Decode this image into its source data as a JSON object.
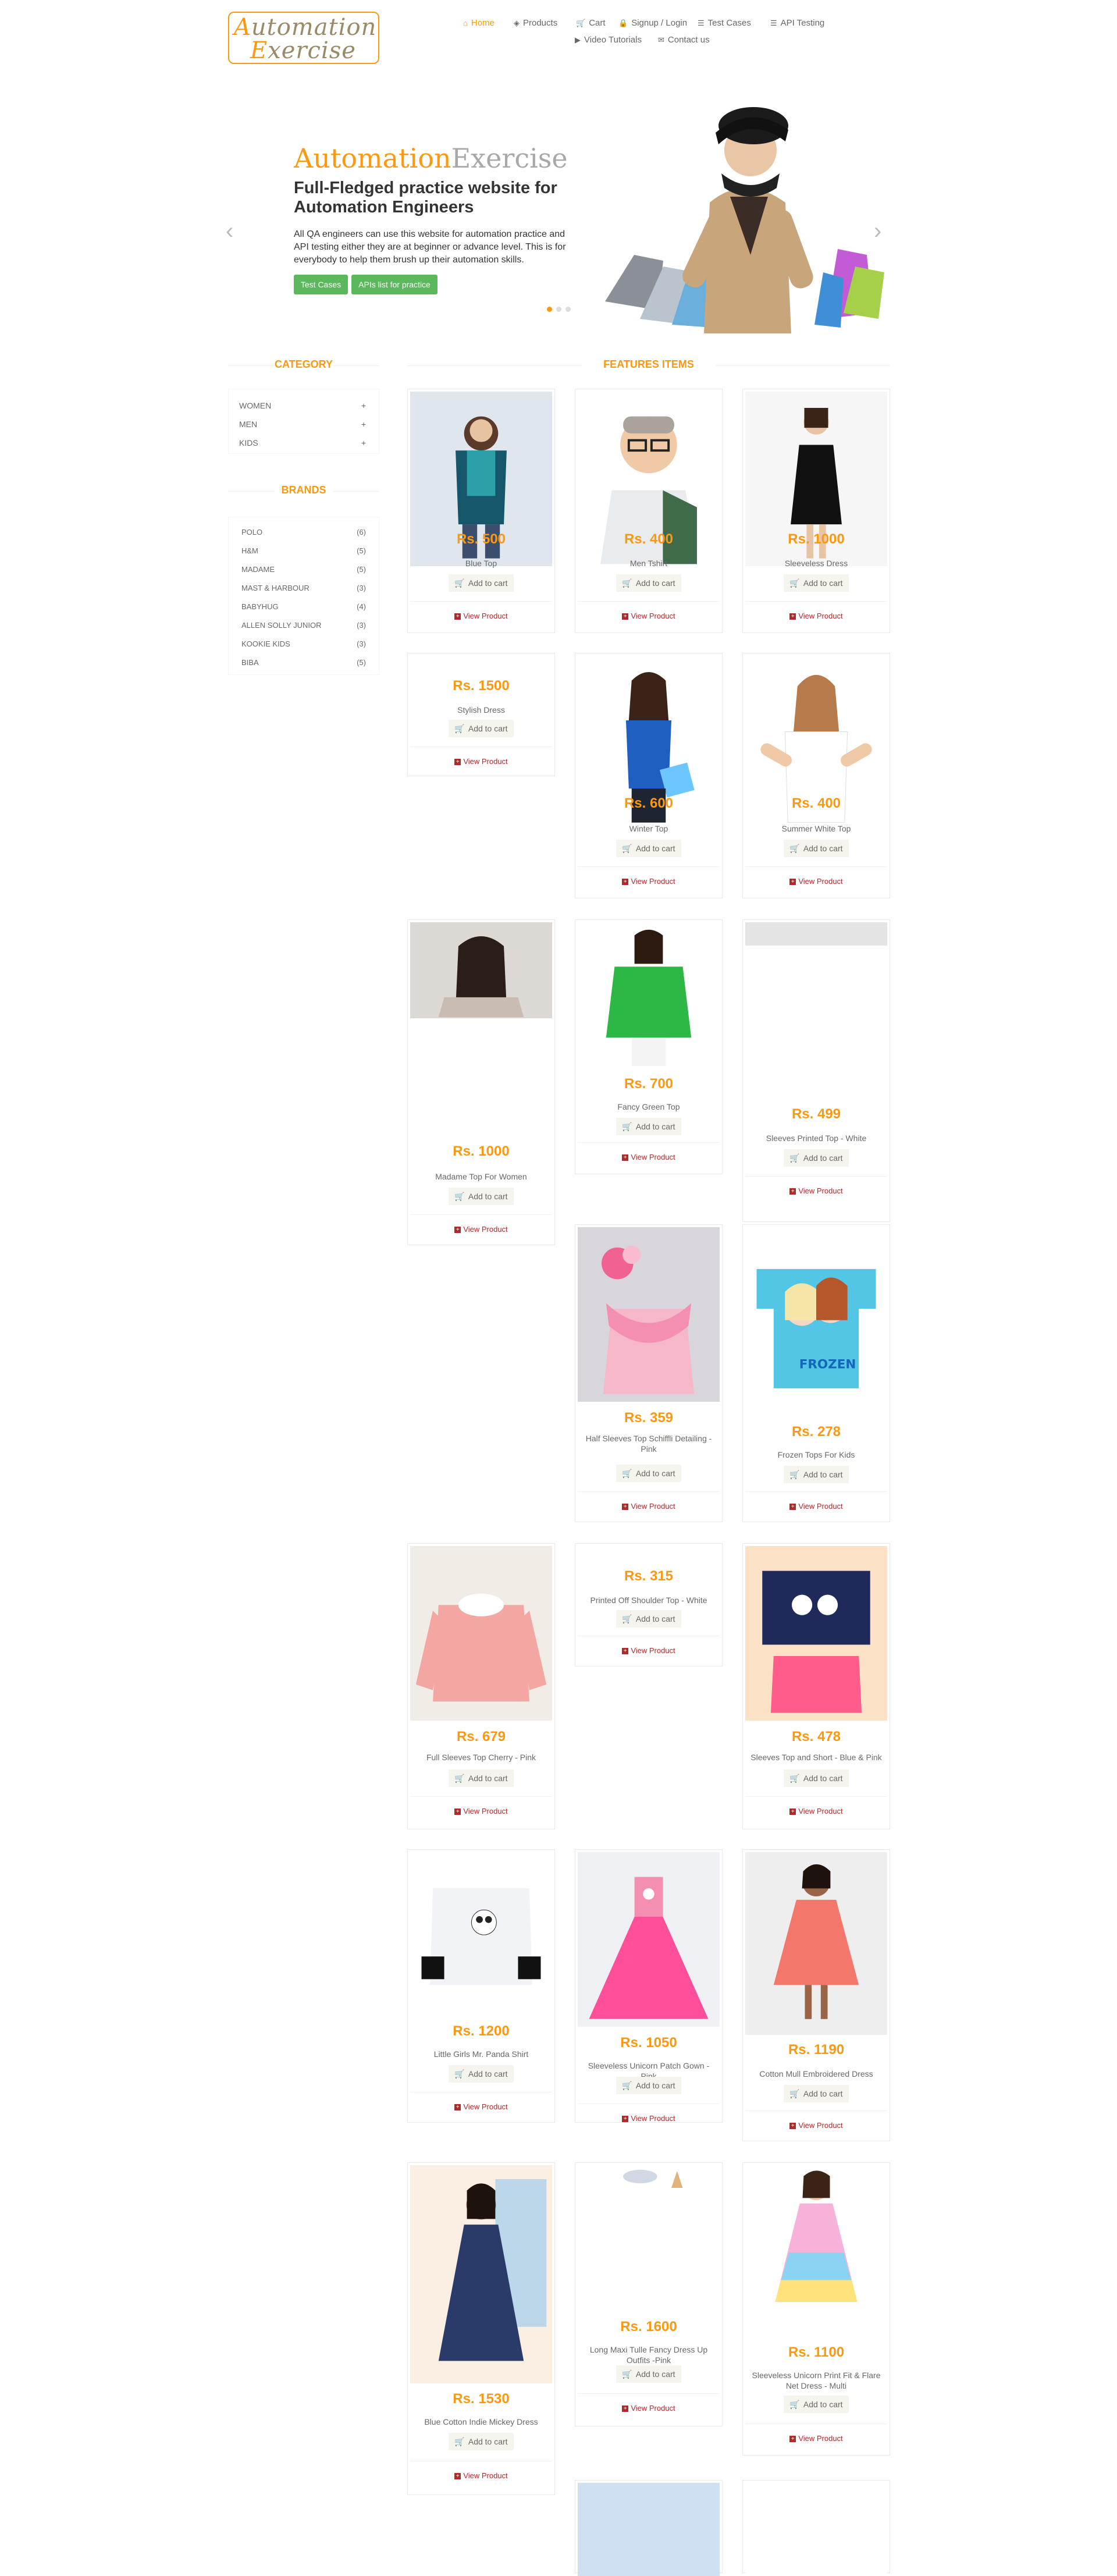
{
  "logo": {
    "part1_first": "A",
    "part1_rest": "utomation",
    "part2_first": "E",
    "part2_rest": "xercise"
  },
  "nav": [
    {
      "label": "Home",
      "icon": "home-icon",
      "glyph": "⌂"
    },
    {
      "label": "Products",
      "icon": "products-icon",
      "glyph": "◈"
    },
    {
      "label": "Cart",
      "icon": "cart-icon",
      "glyph": "🛒"
    },
    {
      "label": "Signup / Login",
      "icon": "lock-icon",
      "glyph": "🔒"
    },
    {
      "label": "Test Cases",
      "icon": "list-icon",
      "glyph": "☰"
    },
    {
      "label": "API Testing",
      "icon": "list-icon",
      "glyph": "☰"
    },
    {
      "label": "Video Tutorials",
      "icon": "youtube-icon",
      "glyph": "▶"
    },
    {
      "label": "Contact us",
      "icon": "envelope-icon",
      "glyph": "✉"
    }
  ],
  "slider": {
    "title_a": "Automation",
    "title_b": "Exercise",
    "heading": "Full-Fledged practice website for Automation Engineers",
    "text": "All QA engineers can use this website for automation practice and API testing either they are at beginner or advance level. This is for everybody to help them brush up their automation skills.",
    "btn_test_cases": "Test Cases",
    "btn_apis": "APIs list for practice",
    "prev": "‹",
    "next": "›"
  },
  "sidebar": {
    "category_title": "CATEGORY",
    "categories": [
      "WOMEN",
      "MEN",
      "KIDS"
    ],
    "brands_title": "BRANDS",
    "brands": [
      {
        "name": "POLO",
        "count": "(6)"
      },
      {
        "name": "H&M",
        "count": "(5)"
      },
      {
        "name": "MADAME",
        "count": "(5)"
      },
      {
        "name": "MAST & HARBOUR",
        "count": "(3)"
      },
      {
        "name": "BABYHUG",
        "count": "(4)"
      },
      {
        "name": "ALLEN SOLLY JUNIOR",
        "count": "(3)"
      },
      {
        "name": "KOOKIE KIDS",
        "count": "(3)"
      },
      {
        "name": "BIBA",
        "count": "(5)"
      }
    ]
  },
  "features_title": "FEATURES ITEMS",
  "add_to_cart_label": "Add to cart",
  "view_product_label": "View Product",
  "products": [
    {
      "price": "Rs. 500",
      "name": "Blue Top"
    },
    {
      "price": "Rs. 400",
      "name": "Men Tshirt"
    },
    {
      "price": "Rs. 1000",
      "name": "Sleeveless Dress"
    },
    {
      "price": "Rs. 1500",
      "name": "Stylish Dress"
    },
    {
      "price": "Rs. 600",
      "name": "Winter Top"
    },
    {
      "price": "Rs. 400",
      "name": "Summer White Top"
    },
    {
      "price": "Rs. 1000",
      "name": "Madame Top For Women"
    },
    {
      "price": "Rs. 700",
      "name": "Fancy Green Top"
    },
    {
      "price": "Rs. 499",
      "name": "Sleeves Printed Top - White"
    },
    {
      "price": "Rs. 359",
      "name": "Half Sleeves Top Schiffli Detailing - Pink"
    },
    {
      "price": "Rs. 278",
      "name": "Frozen Tops For Kids"
    },
    {
      "price": "Rs. 679",
      "name": "Full Sleeves Top Cherry - Pink"
    },
    {
      "price": "Rs. 315",
      "name": "Printed Off Shoulder Top - White"
    },
    {
      "price": "Rs. 478",
      "name": "Sleeves Top and Short - Blue & Pink"
    },
    {
      "price": "Rs. 1200",
      "name": "Little Girls Mr. Panda Shirt"
    },
    {
      "price": "Rs. 1050",
      "name": "Sleeveless Unicorn Patch Gown - Pink"
    },
    {
      "price": "Rs. 1190",
      "name": "Cotton Mull Embroidered Dress"
    },
    {
      "price": "Rs. 1530",
      "name": "Blue Cotton Indie Mickey Dress"
    },
    {
      "price": "Rs. 1600",
      "name": "Long Maxi Tulle Fancy Dress Up Outfits -Pink"
    },
    {
      "price": "Rs. 1100",
      "name": "Sleeveless Unicorn Print Fit & Flare Net Dress - Multi"
    }
  ]
}
